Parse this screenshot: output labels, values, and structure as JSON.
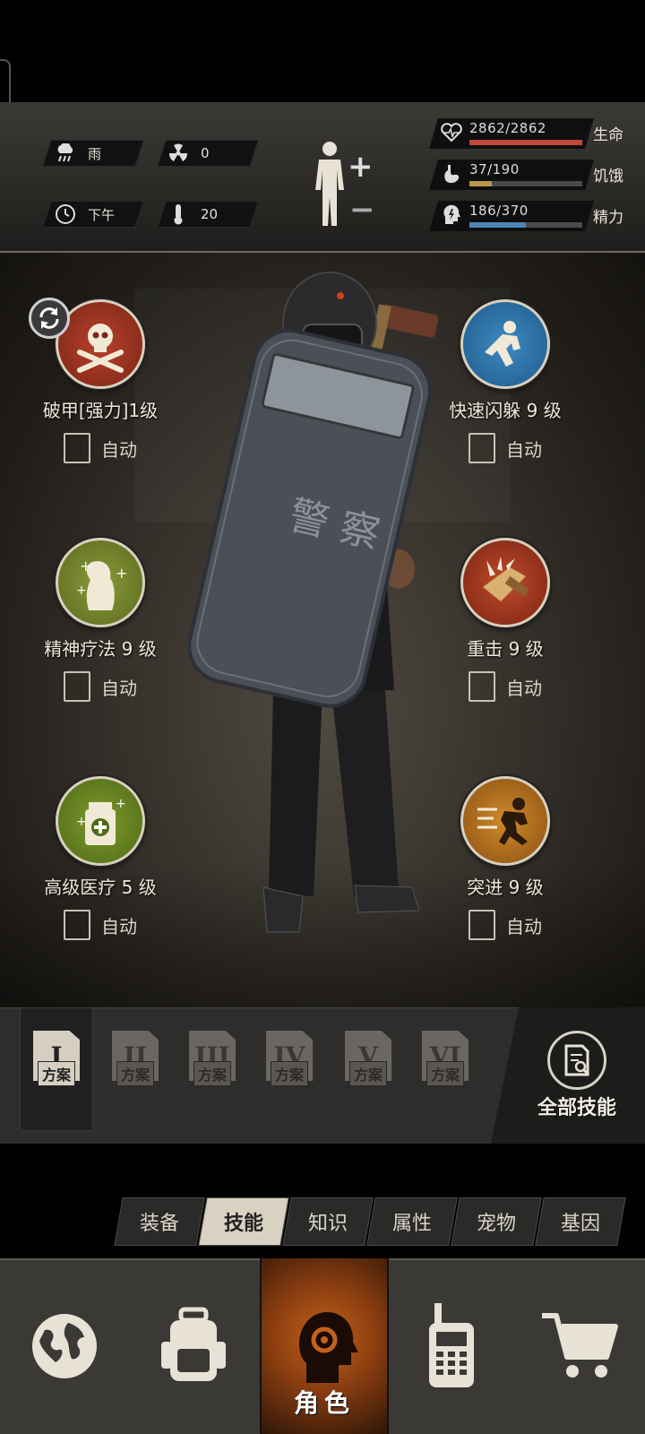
{
  "status": {
    "weather": "雨",
    "radiation": "0",
    "time_of_day": "下午",
    "temperature": "20",
    "health": {
      "value": "2862/2862",
      "label": "生命",
      "fraction": 1.0,
      "color": "#c0463a"
    },
    "hunger": {
      "value": "37/190",
      "label": "饥饿",
      "fraction": 0.195,
      "color": "#b8964a"
    },
    "energy": {
      "value": "186/370",
      "label": "精力",
      "fraction": 0.503,
      "color": "#4d86b5"
    }
  },
  "skills": [
    {
      "name": "破甲[强力]1级",
      "auto_label": "自动",
      "icon": "skull-crossbones-icon"
    },
    {
      "name": "快速闪躲 9 级",
      "auto_label": "自动",
      "icon": "dodge-icon"
    },
    {
      "name": "精神疗法 9 级",
      "auto_label": "自动",
      "icon": "mental-therapy-icon"
    },
    {
      "name": "重击 9 级",
      "auto_label": "自动",
      "icon": "heavy-strike-icon"
    },
    {
      "name": "高级医疗 5 级",
      "auto_label": "自动",
      "icon": "medical-kit-icon"
    },
    {
      "name": "突进 9 级",
      "auto_label": "自动",
      "icon": "charge-icon"
    }
  ],
  "shield_text": "警 察",
  "plans": [
    {
      "numeral": "I",
      "label": "方案"
    },
    {
      "numeral": "II",
      "label": "方案"
    },
    {
      "numeral": "III",
      "label": "方案"
    },
    {
      "numeral": "IV",
      "label": "方案"
    },
    {
      "numeral": "V",
      "label": "方案"
    },
    {
      "numeral": "VI",
      "label": "方案"
    }
  ],
  "all_skills_label": "全部技能",
  "tabs": [
    "装备",
    "技能",
    "知识",
    "属性",
    "宠物",
    "基因"
  ],
  "active_tab": "技能",
  "nav": {
    "active_label": "角色"
  }
}
